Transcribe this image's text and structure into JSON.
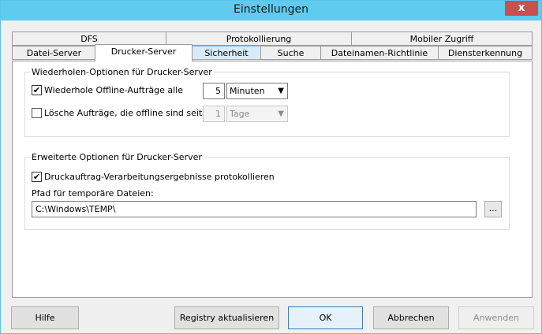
{
  "window": {
    "title": "Einstellungen",
    "close_glyph": "x"
  },
  "tabs_row1": [
    {
      "label": "DFS"
    },
    {
      "label": "Protokollierung"
    },
    {
      "label": "Mobiler Zugriff"
    }
  ],
  "tabs_row2": [
    {
      "label": "Datei-Server"
    },
    {
      "label": "Drucker-Server"
    },
    {
      "label": "Sicherheit"
    },
    {
      "label": "Suche"
    },
    {
      "label": "Dateinamen-Richtlinie"
    },
    {
      "label": "Diensterkennung"
    }
  ],
  "retry_group": {
    "title": "Wiederholen-Optionen für Drucker-Server",
    "retry_offline": {
      "label": "Wiederhole Offline-Aufträge alle",
      "checked": true,
      "value": "5",
      "unit": "Minuten"
    },
    "delete_offline": {
      "label": "Lösche Aufträge, die offline sind seit",
      "checked": false,
      "value": "1",
      "unit": "Tage"
    }
  },
  "advanced_group": {
    "title": "Erweiterte Optionen für Drucker-Server",
    "log_results": {
      "label": "Druckauftrag-Verarbeitungsergebnisse protokollieren",
      "checked": true
    },
    "temp_path_label": "Pfad für temporäre Dateien:",
    "temp_path_value": "C:\\Windows\\TEMP\\",
    "browse_label": "..."
  },
  "buttons": {
    "help": "Hilfe",
    "registry": "Registry aktualisieren",
    "ok": "OK",
    "cancel": "Abbrechen",
    "apply": "Anwenden"
  },
  "check_glyph": "✔"
}
